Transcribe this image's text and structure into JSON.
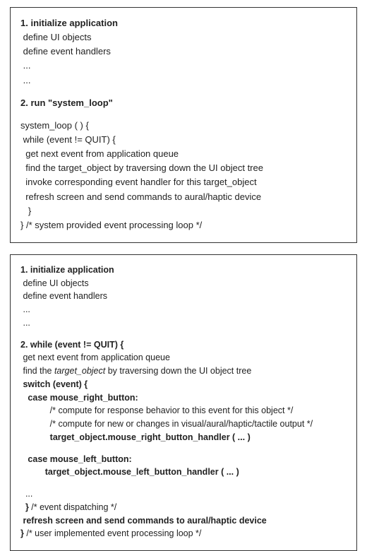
{
  "box1": {
    "l1": "1. initialize application",
    "l2": " define UI objects",
    "l3": " define event handlers",
    "l4": " ...",
    "l5": " ...",
    "l6": "2. run \"system_loop\"",
    "l7": "system_loop ( ) {",
    "l8": " while (event != QUIT) {",
    "l9": "  get next event from application queue",
    "l10": "  find the target_object by traversing down the UI object tree",
    "l11": "  invoke corresponding event handler for this target_object",
    "l12": "  refresh screen and send commands to aural/haptic device",
    "l13": "   }",
    "l14": "} /* system provided event processing loop */"
  },
  "box2": {
    "l1": "1. initialize application",
    "l2": " define UI objects",
    "l3": " define event handlers",
    "l4": " ...",
    "l5": " ...",
    "l6a": "2. while (event != QUIT) {",
    "l7": " get next event from application queue",
    "l8a": " find the ",
    "l8b": "target_object",
    "l8c": " by traversing down the UI object tree",
    "l9": " switch (event) {",
    "l10": "   case mouse_right_button:",
    "l11": "            /* compute for response behavior to this event for this object */",
    "l12": "            /* compute for new or changes in visual/aural/haptic/tactile output */",
    "l13": "            target_object.mouse_right_button_handler ( ... )",
    "l14": "   case mouse_left_button:",
    "l15": "          target_object.mouse_left_button_handler ( ... )",
    "l16": "  ...",
    "l17a": "  } ",
    "l17b": "/* event dispatching */",
    "l18": " refresh screen and send commands to aural/haptic device",
    "l19a": "} ",
    "l19b": "/* user implemented event processing loop */"
  }
}
